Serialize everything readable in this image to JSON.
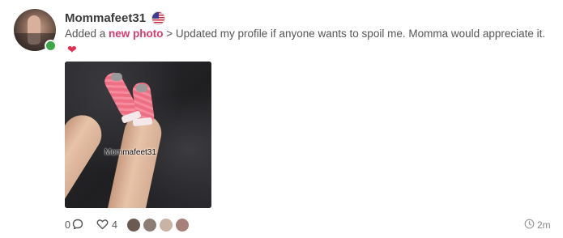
{
  "post": {
    "username": "Mommafeet31",
    "country_flag": "us-flag-icon",
    "online_status": "online",
    "text_prefix": "Added a ",
    "link_text": "new photo",
    "text_suffix": " > Updated my profile if anyone wants to spoil me. Momma would appreciate it.",
    "emoji": "red-heart-icon",
    "photo_watermark": "Mommafeet31"
  },
  "footer": {
    "comment_count": "0",
    "like_count": "4",
    "time_ago": "2m",
    "liker_avatars": [
      "#6b5a52",
      "#8c7c74",
      "#c9b3a4",
      "#a7807a"
    ]
  },
  "colors": {
    "link": "#d83a6b",
    "online": "#3aa847",
    "heart": "#e0304f"
  }
}
